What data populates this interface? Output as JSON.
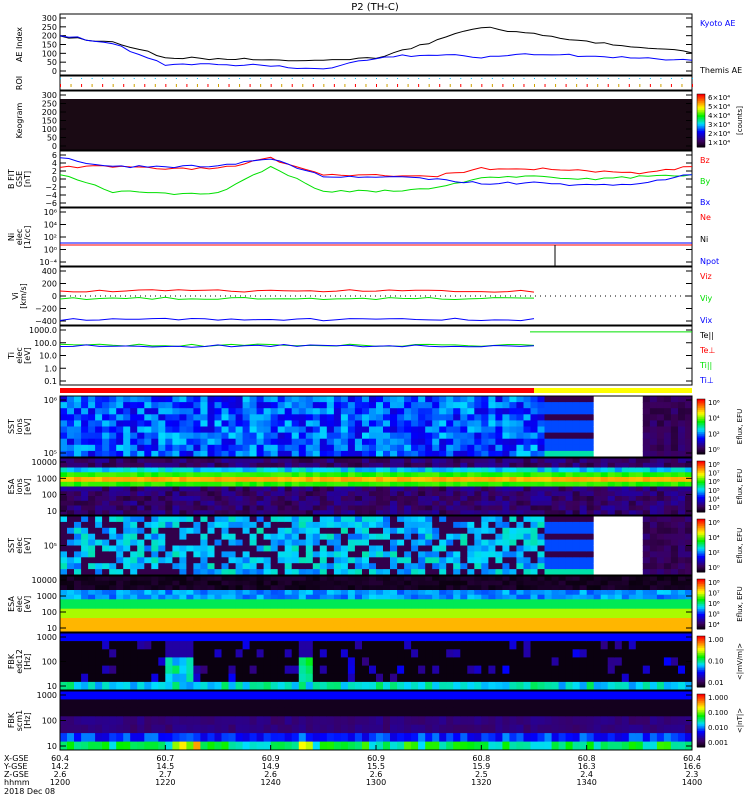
{
  "title": "P2 (TH-C)",
  "colors": {
    "red": "#ff0000",
    "green": "#00e000",
    "blue": "#0000ff",
    "black": "#000000",
    "yellow": "#ffff00"
  },
  "panels": [
    {
      "id": "ae",
      "ylabel": [
        "AE Index"
      ],
      "ticks": [
        "300",
        "250",
        "200",
        "150",
        "100",
        "50",
        "0"
      ],
      "legend": [
        {
          "text": "Kyoto AE",
          "color": "#0000ff"
        },
        {
          "text": "Themis AE",
          "color": "#000000"
        }
      ]
    },
    {
      "id": "roi",
      "ylabel": [
        "ROI"
      ],
      "ticks": [],
      "legend": []
    },
    {
      "id": "keogram",
      "ylabel": [
        "Keogram"
      ],
      "ticks": [
        "300",
        "250",
        "200",
        "150",
        "100",
        "50",
        "0"
      ],
      "legend": [],
      "colorbar": {
        "ticks": [
          "6×10⁴",
          "5×10⁴",
          "4×10⁴",
          "3×10⁴",
          "2×10⁴",
          "1×10⁴"
        ],
        "unit": "[counts]"
      }
    },
    {
      "id": "bfit",
      "ylabel": [
        "B FIT",
        "GSE",
        "[nT]"
      ],
      "ticks": [
        "6",
        "4",
        "2",
        "0",
        "−2",
        "−4",
        "−6"
      ],
      "legend": [
        {
          "text": "Bz",
          "color": "#ff0000"
        },
        {
          "text": "By",
          "color": "#00e000"
        },
        {
          "text": "Bx",
          "color": "#0000ff"
        }
      ]
    },
    {
      "id": "ni",
      "ylabel": [
        "Ni",
        "elec",
        "[1/cc]"
      ],
      "ticks": [
        "10⁶",
        "10⁴",
        "10²",
        "10⁰",
        "10⁻⁴"
      ],
      "legend": [
        {
          "text": "Ne",
          "color": "#ff0000"
        },
        {
          "text": "Ni",
          "color": "#000000"
        },
        {
          "text": "Npot",
          "color": "#0000ff"
        }
      ]
    },
    {
      "id": "vi",
      "ylabel": [
        "Vi",
        "[km/s]"
      ],
      "ticks": [
        "400",
        "200",
        "0",
        "−200",
        "−400"
      ],
      "legend": [
        {
          "text": "Viz",
          "color": "#ff0000"
        },
        {
          "text": "Viy",
          "color": "#00e000"
        },
        {
          "text": "Vix",
          "color": "#0000ff"
        }
      ]
    },
    {
      "id": "ti",
      "ylabel": [
        "Ti",
        "elec",
        "[eV]"
      ],
      "ticks": [
        "1000.0",
        "100.0",
        "10.0",
        "1.0",
        "0.1"
      ],
      "legend": [
        {
          "text": "Te||",
          "color": "#000000"
        },
        {
          "text": "Te⊥",
          "color": "#ff0000"
        },
        {
          "text": "Ti||",
          "color": "#00e000"
        },
        {
          "text": "Ti⊥",
          "color": "#0000ff"
        }
      ]
    },
    {
      "id": "sst_i",
      "ylabel": [
        "SST",
        "ions",
        "[eV]"
      ],
      "ticks": [
        "10⁶",
        "10⁵"
      ],
      "colorbar": {
        "ticks": [
          "10⁶",
          "10⁴",
          "10²",
          "10⁰"
        ],
        "unit": "Eflux, EFU"
      }
    },
    {
      "id": "esa_i",
      "ylabel": [
        "ESA",
        "ions",
        "[eV]"
      ],
      "ticks": [
        "10000",
        "1000",
        "100",
        "10"
      ],
      "colorbar": {
        "ticks": [
          "10⁸",
          "10⁷",
          "10⁶",
          "10⁵",
          "10⁴",
          "10³"
        ],
        "unit": "Eflux, EFU"
      }
    },
    {
      "id": "sst_e",
      "ylabel": [
        "SST",
        "elec",
        "[eV]"
      ],
      "ticks": [
        "10⁵"
      ],
      "colorbar": {
        "ticks": [
          "10⁶",
          "10⁴",
          "10²",
          "10⁰"
        ],
        "unit": "Eflux, EFU"
      }
    },
    {
      "id": "esa_e",
      "ylabel": [
        "ESA",
        "elec",
        "[eV]"
      ],
      "ticks": [
        "10000",
        "1000",
        "100",
        "10"
      ],
      "colorbar": {
        "ticks": [
          "10⁸",
          "10⁷",
          "10⁶",
          "10⁵",
          "10⁴"
        ],
        "unit": "Eflux, EFU"
      }
    },
    {
      "id": "fbk_e",
      "ylabel": [
        "FBK",
        "edc12",
        "[Hz]"
      ],
      "ticks": [
        "1000",
        "100",
        "10"
      ],
      "colorbar": {
        "ticks": [
          "1.00",
          "0.10",
          "0.01"
        ],
        "unit": "<|mV/m|>"
      }
    },
    {
      "id": "fbk_b",
      "ylabel": [
        "FBK",
        "scm1",
        "[Hz]"
      ],
      "ticks": [
        "1000",
        "100",
        "10"
      ],
      "colorbar": {
        "ticks": [
          "1.000",
          "0.100",
          "0.010",
          "0.001"
        ],
        "unit": "<|nT|>"
      }
    }
  ],
  "xaxis": {
    "rows": [
      {
        "label": "X-GSE",
        "values": [
          "60.4",
          "60.7",
          "60.9",
          "60.9",
          "60.8",
          "60.8",
          "60.4"
        ]
      },
      {
        "label": "Y-GSE",
        "values": [
          "14.2",
          "14.5",
          "14.9",
          "15.5",
          "15.9",
          "16.3",
          "16.6"
        ]
      },
      {
        "label": "Z-GSE",
        "values": [
          "2.6",
          "2.7",
          "2.6",
          "2.6",
          "2.5",
          "2.4",
          "2.3"
        ]
      },
      {
        "label": "hhmm",
        "values": [
          "1200",
          "1220",
          "1240",
          "1300",
          "1320",
          "1340",
          "1400"
        ]
      }
    ],
    "date": "2018 Dec 08"
  },
  "chart_data": {
    "type": "line",
    "x_minutes": [
      0,
      10,
      20,
      30,
      40,
      50,
      60,
      70,
      80,
      90,
      100,
      110,
      120
    ],
    "xlim": [
      0,
      120
    ],
    "series": {
      "themis_ae": [
        200,
        175,
        95,
        85,
        80,
        80,
        90,
        170,
        255,
        215,
        175,
        150,
        120
      ],
      "kyoto_ae": [
        210,
        165,
        55,
        55,
        50,
        30,
        90,
        110,
        95,
        110,
        100,
        90,
        80
      ],
      "bz": [
        3,
        3,
        2.5,
        2.5,
        5,
        1,
        1,
        0.5,
        2.5,
        2.5,
        2,
        1.5,
        3
      ],
      "by": [
        1,
        -3,
        -3.5,
        -3.5,
        3,
        -3,
        -3,
        -2.5,
        0.5,
        0.5,
        0,
        0.5,
        1
      ],
      "bx": [
        5,
        3,
        3,
        3,
        5,
        0.5,
        0.5,
        0,
        -1,
        -1,
        -1.5,
        -1,
        1
      ],
      "viz": [
        100,
        100,
        100,
        100,
        100,
        100,
        100
      ],
      "viy": [
        -50,
        -50,
        -50,
        -50,
        -50,
        -50,
        -50
      ],
      "vix": [
        -470,
        -470,
        -470,
        -470,
        -470,
        -470,
        -470
      ],
      "ti": [
        60,
        60,
        60,
        65,
        60,
        60,
        60
      ]
    },
    "ylim": {
      "ae": [
        0,
        300
      ],
      "b": [
        -6,
        6
      ],
      "vi": [
        -500,
        500
      ]
    },
    "mode_bar": [
      {
        "color": "#ff0000",
        "from": 0,
        "to": 90
      },
      {
        "color": "#ffff00",
        "from": 90,
        "to": 120
      }
    ]
  }
}
